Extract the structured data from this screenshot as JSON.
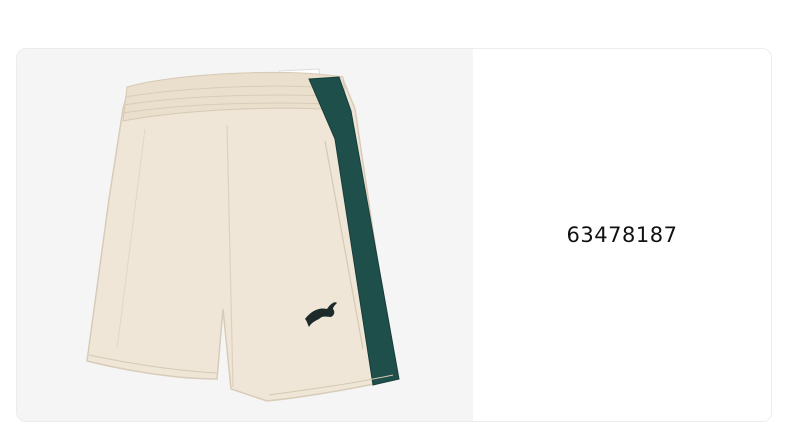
{
  "product": {
    "code": "63478187",
    "image_alt": "shorts",
    "colors": {
      "fabric": "#efe6d7",
      "stripe": "#1f4f4a",
      "background": "#f5f5f5"
    },
    "logo_icon": "puma-cat-icon"
  }
}
